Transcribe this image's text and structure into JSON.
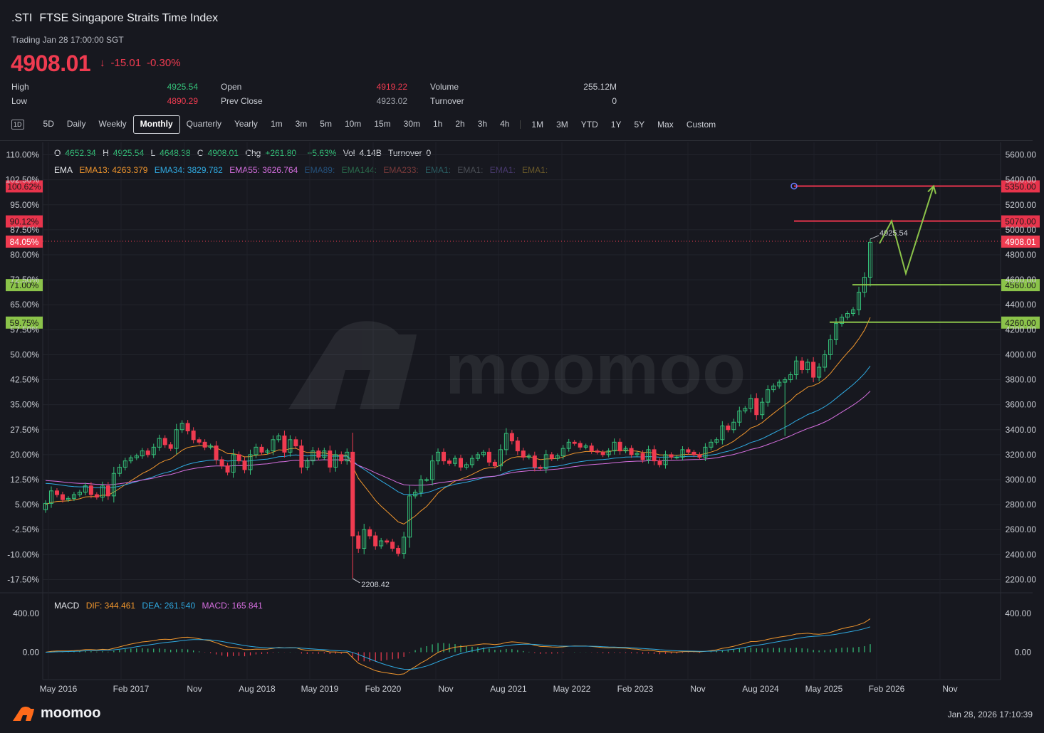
{
  "header": {
    "symbol": ".STI",
    "name": "FTSE Singapore Straits Time Index",
    "status": "Trading Jan 28 17:00:00 SGT",
    "price": "4908.01",
    "arrow": "↓",
    "change": "-15.01",
    "change_pct": "-0.30%"
  },
  "stats": {
    "high_label": "High",
    "high": "4925.54",
    "low_label": "Low",
    "low": "4890.29",
    "open_label": "Open",
    "open": "4919.22",
    "prev_close_label": "Prev Close",
    "prev_close": "4923.02",
    "volume_label": "Volume",
    "volume": "255.12M",
    "turnover_label": "Turnover",
    "turnover": "0"
  },
  "timeframes": {
    "icon_label": "1D",
    "items_a": [
      "5D",
      "Daily",
      "Weekly",
      "Monthly",
      "Quarterly",
      "Yearly",
      "1m",
      "3m",
      "5m",
      "10m",
      "15m",
      "30m",
      "1h",
      "2h",
      "3h",
      "4h"
    ],
    "items_b": [
      "1M",
      "3M",
      "YTD",
      "1Y",
      "5Y",
      "Max",
      "Custom"
    ],
    "selected": "Monthly"
  },
  "legend": {
    "o_label": "O",
    "o": "4652.34",
    "h_label": "H",
    "h": "4925.54",
    "l_label": "L",
    "l": "4648.38",
    "c_label": "C",
    "c": "4908.01",
    "chg_label": "Chg",
    "chg": "+261.80",
    "chg_pct": "+5.63%",
    "vol_label": "Vol",
    "vol": "4.14B",
    "turnover_label": "Turnover",
    "turnover": "0"
  },
  "ema_legend": {
    "label": "EMA",
    "ema13": "EMA13: 4263.379",
    "ema34": "EMA34: 3829.782",
    "ema55": "EMA55: 3626.764",
    "ema89": "EMA89:",
    "ema144": "EMA144:",
    "ema233": "EMA233:",
    "emaA": "EMA1:",
    "emaB": "EMA1:",
    "emaC": "EMA1:",
    "emaD": "EMA1:"
  },
  "macd_legend": {
    "label": "MACD",
    "dif": "DIF: 344.461",
    "dea": "DEA: 261.540",
    "macd": "MACD: 165.841"
  },
  "colors": {
    "up": "#35c27a",
    "down": "#ef3b50",
    "ema13": "#f0962d",
    "ema34": "#2fa9e0",
    "ema55": "#d66fe0",
    "hline_red": "#e8344c",
    "hline_green": "#8bc34a",
    "arrow": "#8bc34a"
  },
  "chart_data": {
    "type": "candlestick",
    "title": ".STI FTSE Singapore Straits Time Index",
    "interval": "Monthly",
    "ylim": [
      2100,
      5700
    ],
    "y_ticks_price": [
      "5600.00",
      "5400.00",
      "5200.00",
      "5000.00",
      "4800.00",
      "4600.00",
      "4400.00",
      "4200.00",
      "4000.00",
      "3800.00",
      "3600.00",
      "3400.00",
      "3200.00",
      "3000.00",
      "2800.00",
      "2600.00",
      "2400.00",
      "2200.00"
    ],
    "y_ticks_pct": [
      "110.00%",
      "102.50%",
      "95.00%",
      "87.50%",
      "80.00%",
      "72.50%",
      "65.00%",
      "57.50%",
      "50.00%",
      "42.50%",
      "35.00%",
      "27.50%",
      "20.00%",
      "12.50%",
      "5.00%",
      "-2.50%",
      "-10.00%",
      "-17.50%"
    ],
    "x_ticks": [
      "May 2016",
      "Feb 2017",
      "Nov",
      "Aug 2018",
      "May 2019",
      "Feb 2020",
      "Nov",
      "Aug 2021",
      "May 2022",
      "Feb 2023",
      "Nov",
      "Aug 2024",
      "May 2025",
      "Feb 2026",
      "Nov"
    ],
    "annotations": {
      "high_marker": "4925.54",
      "low_marker": "2208.42"
    },
    "last_price_tag": {
      "price": "4908.01",
      "pct": "84.05%"
    },
    "hlines": [
      {
        "price": "5350.00",
        "pct": "100.62%",
        "color": "red"
      },
      {
        "price": "5070.00",
        "pct": "90.12%",
        "color": "red"
      },
      {
        "price": "4560.00",
        "pct": "71.00%",
        "color": "green"
      },
      {
        "price": "4260.00",
        "pct": "59.75%",
        "color": "green"
      }
    ],
    "projection_path": [
      4890,
      5070,
      4650,
      5350
    ],
    "closes": [
      2810,
      2910,
      2880,
      2840,
      2850,
      2880,
      2900,
      2950,
      2880,
      2860,
      2950,
      2870,
      3050,
      3100,
      3150,
      3175,
      3190,
      3230,
      3200,
      3260,
      3330,
      3280,
      3250,
      3400,
      3450,
      3390,
      3320,
      3300,
      3260,
      3270,
      3160,
      3110,
      3060,
      3200,
      3150,
      3080,
      3200,
      3260,
      3220,
      3230,
      3320,
      3350,
      3220,
      3320,
      3270,
      3100,
      3150,
      3230,
      3180,
      3230,
      3100,
      3200,
      3150,
      3220,
      2550,
      2450,
      2600,
      2550,
      2470,
      2510,
      2500,
      2450,
      2410,
      2540,
      2870,
      2900,
      3000,
      3000,
      3150,
      3220,
      3150,
      3130,
      3170,
      3100,
      3120,
      3170,
      3200,
      3220,
      3140,
      3110,
      3240,
      3370,
      3310,
      3230,
      3180,
      3190,
      3100,
      3090,
      3200,
      3170,
      3190,
      3250,
      3300,
      3290,
      3260,
      3270,
      3230,
      3220,
      3200,
      3230,
      3300,
      3230,
      3250,
      3200,
      3210,
      3160,
      3240,
      3150,
      3120,
      3200,
      3180,
      3180,
      3240,
      3220,
      3200,
      3180,
      3260,
      3300,
      3320,
      3430,
      3400,
      3460,
      3550,
      3570,
      3650,
      3520,
      3620,
      3720,
      3750,
      3780,
      3800,
      3840,
      3950,
      3880,
      3940,
      3820,
      3900,
      4000,
      4120,
      4250,
      4300,
      4330,
      4360,
      4500,
      4620,
      4900
    ],
    "macd": {
      "ylim": [
        -260,
        560
      ],
      "y_ticks": [
        "400.00",
        "0.00"
      ],
      "dif_last": 344.461,
      "dea_last": 261.54,
      "hist_last": 165.841
    }
  }
}
